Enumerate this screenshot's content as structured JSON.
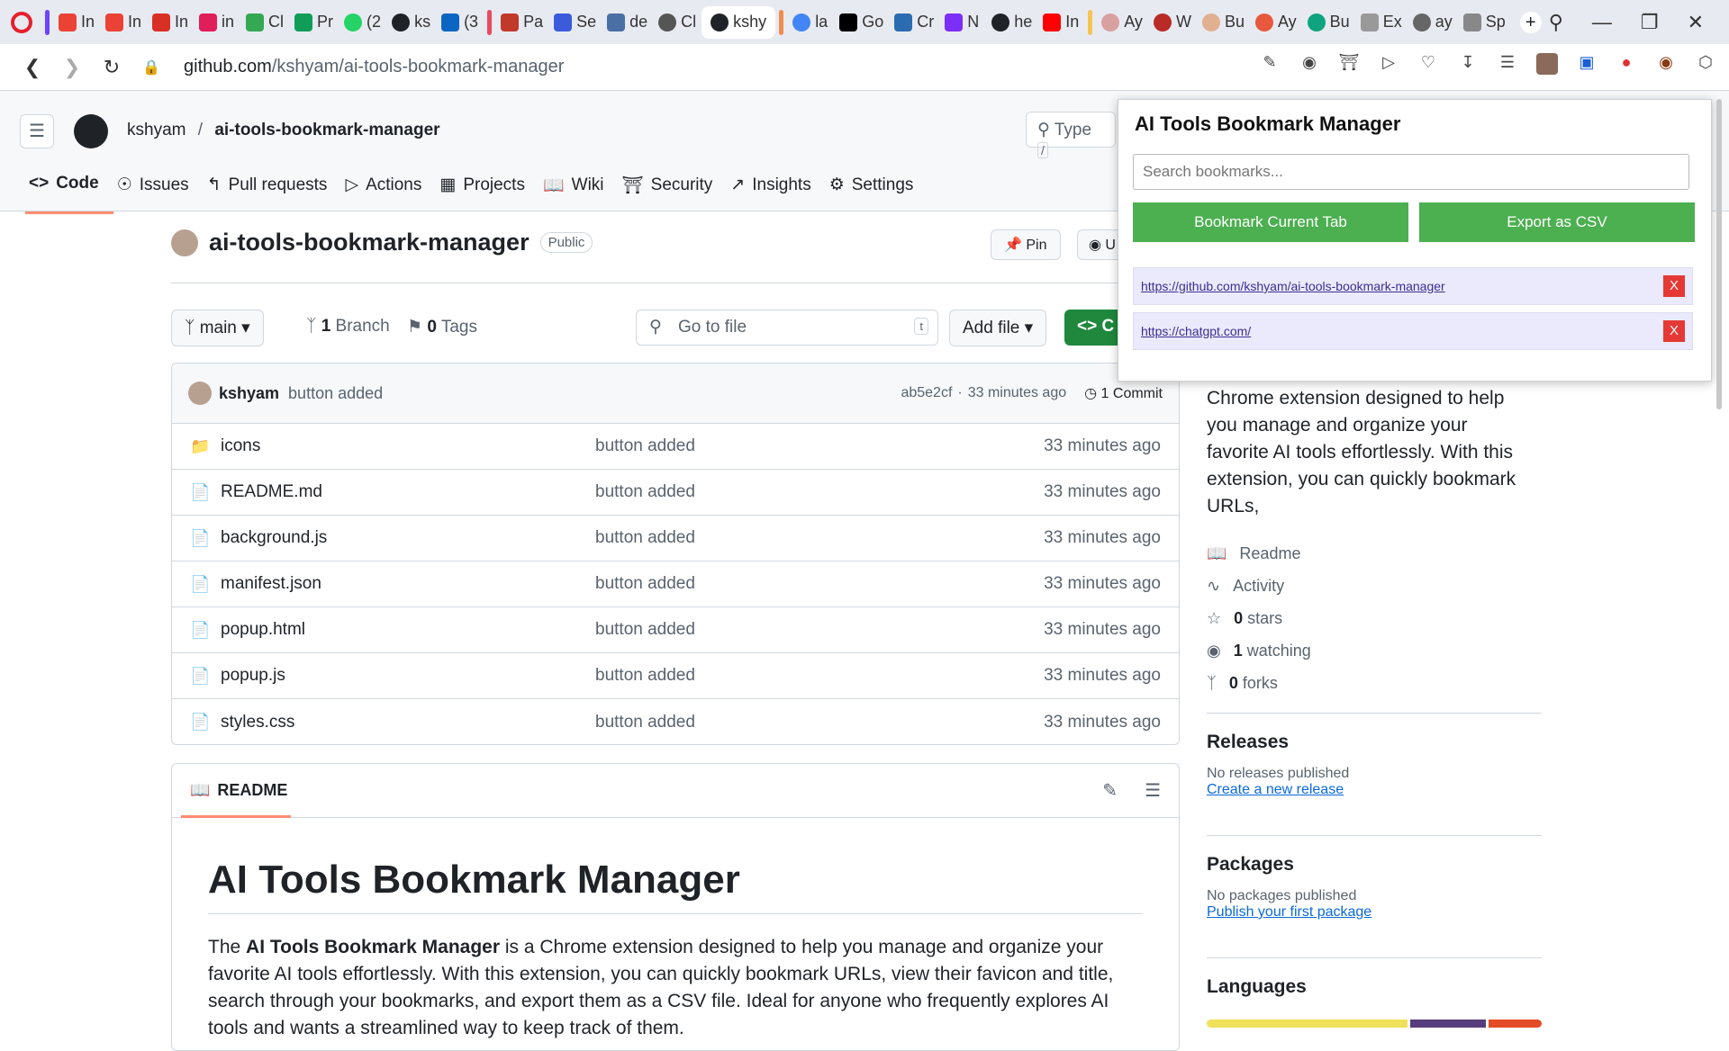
{
  "browser": {
    "tabs": [
      "In",
      "In",
      "In",
      "in",
      "Cl",
      "Pr",
      "(2",
      "ks",
      "(3",
      "Pa",
      "Se",
      "de",
      "Cl",
      "kshy",
      "la",
      "Go",
      "Cr",
      "N",
      "he",
      "In",
      "Ay",
      "W",
      "Bu",
      "Ay",
      "Bu",
      "Ex",
      "ay",
      "Sp"
    ],
    "active_tab": "kshy",
    "url_domain": "github.com",
    "url_path": "/kshyam/ai-tools-bookmark-manager"
  },
  "github": {
    "owner": "kshyam",
    "repo": "ai-tools-bookmark-manager",
    "search_placeholder": "Type",
    "search_key": "/",
    "tabs": [
      "Code",
      "Issues",
      "Pull requests",
      "Actions",
      "Projects",
      "Wiki",
      "Security",
      "Insights",
      "Settings"
    ],
    "visibility": "Public",
    "pin_label": "Pin",
    "watch_label": "U",
    "branch": "main",
    "branch_count": "1",
    "branch_label": "Branch",
    "tag_count": "0",
    "tag_label": "Tags",
    "goto_placeholder": "Go to file",
    "goto_key": "t",
    "add_file": "Add file",
    "code_btn": "C",
    "commit": {
      "author": "kshyam",
      "message": "button added",
      "hash": "ab5e2cf",
      "time": "33 minutes ago",
      "count": "1 Commit"
    },
    "files": [
      {
        "name": "icons",
        "message": "button added",
        "time": "33 minutes ago",
        "type": "folder"
      },
      {
        "name": "README.md",
        "message": "button added",
        "time": "33 minutes ago",
        "type": "file"
      },
      {
        "name": "background.js",
        "message": "button added",
        "time": "33 minutes ago",
        "type": "file"
      },
      {
        "name": "manifest.json",
        "message": "button added",
        "time": "33 minutes ago",
        "type": "file"
      },
      {
        "name": "popup.html",
        "message": "button added",
        "time": "33 minutes ago",
        "type": "file"
      },
      {
        "name": "popup.js",
        "message": "button added",
        "time": "33 minutes ago",
        "type": "file"
      },
      {
        "name": "styles.css",
        "message": "button added",
        "time": "33 minutes ago",
        "type": "file"
      }
    ],
    "readme": {
      "tab": "README",
      "title": "AI Tools Bookmark Manager",
      "intro_prefix": "The ",
      "intro_bold": "AI Tools Bookmark Manager",
      "intro_rest": " is a Chrome extension designed to help you manage and organize your favorite AI tools effortlessly. With this extension, you can quickly bookmark URLs, view their favicon and title, search through your bookmarks, and export them as a CSV file. Ideal for anyone who frequently explores AI tools and wants a streamlined way to keep track of them."
    },
    "about_text": "Chrome extension designed to help you manage and organize your favorite AI tools effortlessly. With this extension, you can quickly bookmark URLs,",
    "meta": {
      "readme": "Readme",
      "activity": "Activity",
      "stars_count": "0",
      "stars": "stars",
      "watching_count": "1",
      "watching": "watching",
      "forks_count": "0",
      "forks": "forks"
    },
    "releases": {
      "title": "Releases",
      "empty": "No releases published",
      "link": "Create a new release"
    },
    "packages": {
      "title": "Packages",
      "empty": "No packages published",
      "link": "Publish your first package"
    },
    "languages": {
      "title": "Languages",
      "colors": [
        "#f1e05a",
        "#563d7c",
        "#e34c26"
      ],
      "shares": [
        0.61,
        0.23,
        0.16
      ]
    }
  },
  "popup": {
    "title": "AI Tools Bookmark Manager",
    "search_placeholder": "Search bookmarks...",
    "bookmark_btn": "Bookmark Current Tab",
    "export_btn": "Export as CSV",
    "bookmarks": [
      "https://github.com/kshyam/ai-tools-bookmark-manager",
      "https://chatgpt.com/"
    ],
    "delete_label": "X",
    "button_color": "#4caf50",
    "delete_color": "#e53935"
  }
}
